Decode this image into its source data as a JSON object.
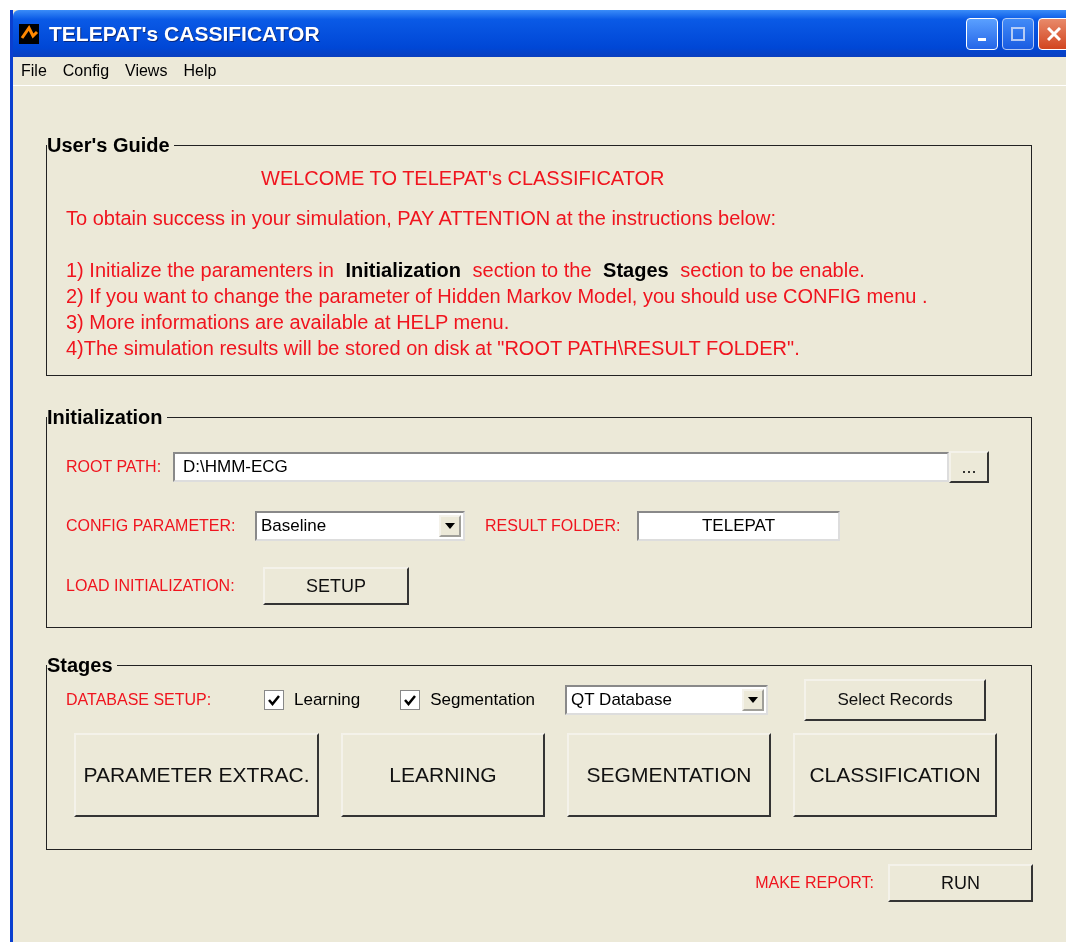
{
  "window": {
    "title": "TELEPAT's CASSIFICATOR"
  },
  "menu": [
    {
      "label": "File"
    },
    {
      "label": "Config"
    },
    {
      "label": "Views"
    },
    {
      "label": "Help"
    }
  ],
  "guide": {
    "title": "User's Guide",
    "heading": "WELCOME TO TELEPAT's CLASSIFICATOR",
    "intro": "To obtain success in your simulation, PAY ATTENTION at  the instructions below:",
    "instructions": [
      "1) Initialize the paramenters in **Initialization** section to the **Stages** section to be enable.",
      "2) If you want to change the parameter of Hidden Markov Model, you should use CONFIG menu .",
      "3) More informations are available at HELP menu.",
      "4)The simulation results will be stored on disk at  \"ROOT PATH\\RESULT FOLDER\"."
    ]
  },
  "initialization": {
    "title": "Initialization",
    "root_path": {
      "label": "ROOT PATH:",
      "value": "D:\\HMM-ECG",
      "browse": "..."
    },
    "config_parameter": {
      "label": "CONFIG PARAMETER:",
      "value": "Baseline"
    },
    "result_folder": {
      "label": "RESULT FOLDER:",
      "value": "TELEPAT"
    },
    "load": {
      "label": "LOAD INITIALIZATION:",
      "button": "SETUP"
    }
  },
  "stages": {
    "title": "Stages",
    "database_label": "DATABASE SETUP:",
    "checkboxes": [
      {
        "label": "Learning",
        "checked": true
      },
      {
        "label": "Segmentation",
        "checked": true
      }
    ],
    "database": "QT Database",
    "select_button": "Select Records",
    "actions": [
      "PARAMETER EXTRAC.",
      "LEARNING",
      "SEGMENTATION",
      "CLASSIFICATION"
    ]
  },
  "report": {
    "label": "MAKE REPORT:",
    "button": "RUN"
  }
}
